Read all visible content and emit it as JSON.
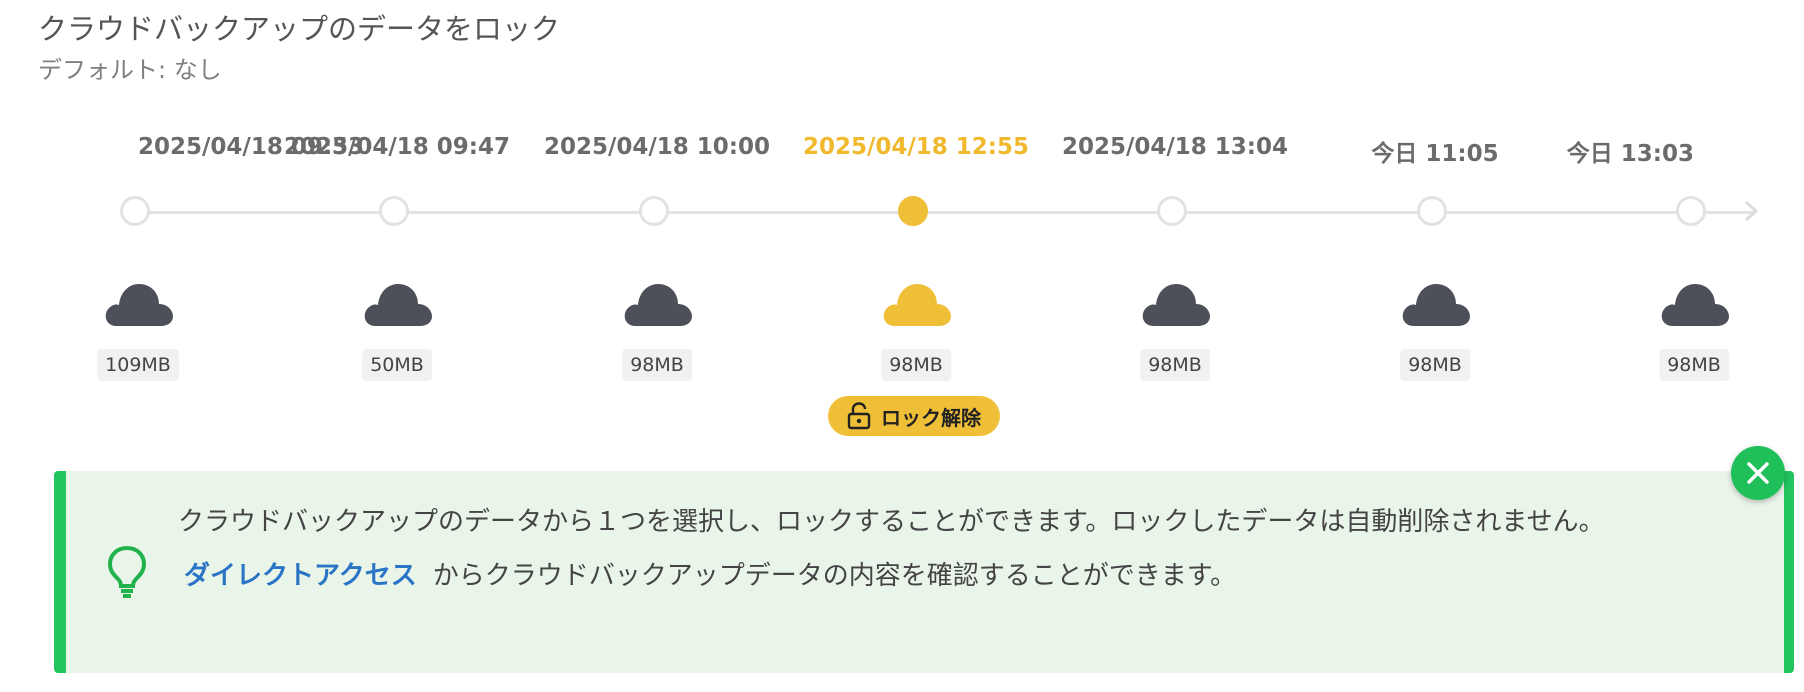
{
  "header": {
    "title": "クラウドバックアップのデータをロック",
    "subtitle": "デフォルト: なし"
  },
  "timeline": {
    "nodes": [
      {
        "date": "2025/04/18 09:33",
        "size": "109MB",
        "active": false
      },
      {
        "date": "2025/04/18 09:47",
        "size": "50MB",
        "active": false
      },
      {
        "date": "2025/04/18 10:00",
        "size": "98MB",
        "active": false
      },
      {
        "date": "2025/04/18 12:55",
        "size": "98MB",
        "active": true
      },
      {
        "date": "2025/04/18 13:04",
        "size": "98MB",
        "active": false
      },
      {
        "date": "今日 11:05",
        "size": "98MB",
        "active": false
      },
      {
        "date": "今日 13:03",
        "size": "98MB",
        "active": false
      }
    ],
    "unlock_label": "ロック解除"
  },
  "info": {
    "line1": "クラウドバックアップのデータから１つを選択し、ロックすることができます。ロックしたデータは自動削除されません。",
    "link_text": "ダイレクトアクセス",
    "line2_rest": "からクラウドバックアップデータの内容を確認することができます。"
  },
  "colors": {
    "accent_yellow": "#f0bf38",
    "cloud_gray": "#4d5058",
    "success_green": "#22c55e",
    "info_bg": "#eaf5ea",
    "link_blue": "#2a74c6"
  },
  "icons": {
    "cloud": "cloud-icon",
    "lock": "unlock-icon",
    "bulb": "lightbulb-icon",
    "close": "close-icon",
    "arrow": "arrow-right-icon"
  }
}
